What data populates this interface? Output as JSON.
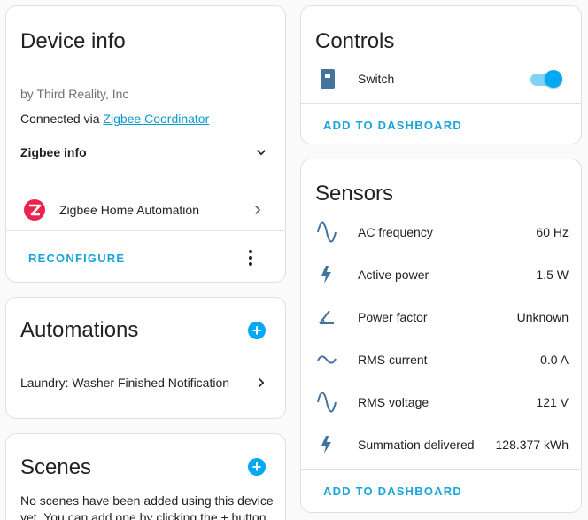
{
  "device_info": {
    "title": "Device info",
    "manufacturer": "by Third Reality, Inc",
    "connected_prefix": "Connected via ",
    "connected_link": "Zigbee Coordinator",
    "zigbee_info_label": "Zigbee info",
    "integration_label": "Zigbee Home Automation",
    "reconfigure_label": "RECONFIGURE",
    "integration_icon": "zigbee-logo-icon"
  },
  "automations": {
    "title": "Automations",
    "items": [
      {
        "label": "Laundry: Washer Finished Notification"
      }
    ]
  },
  "scenes": {
    "title": "Scenes",
    "empty_text_line1": "No scenes have been added using this device",
    "empty_text_line2": "yet. You can add one by clicking the + button"
  },
  "controls": {
    "title": "Controls",
    "items": [
      {
        "label": "Switch",
        "icon": "power-socket-icon",
        "state": "on"
      }
    ],
    "add_to_dashboard_label": "ADD TO DASHBOARD"
  },
  "sensors": {
    "title": "Sensors",
    "items": [
      {
        "label": "AC frequency",
        "value": "60 Hz",
        "icon": "sine-wave-icon"
      },
      {
        "label": "Active power",
        "value": "1.5 W",
        "icon": "lightning-bolt-icon"
      },
      {
        "label": "Power factor",
        "value": "Unknown",
        "icon": "angle-icon"
      },
      {
        "label": "RMS current",
        "value": "0.0 A",
        "icon": "current-ac-icon"
      },
      {
        "label": "RMS voltage",
        "value": "121 V",
        "icon": "sine-wave-icon"
      },
      {
        "label": "Summation delivered",
        "value": "128.377 kWh",
        "icon": "lightning-bolt-icon"
      }
    ],
    "add_to_dashboard_label": "ADD TO DASHBOARD"
  },
  "colors": {
    "accent": "#03a9f4",
    "link": "#0a9bcf",
    "action": "#1aa5d9",
    "zigbee": "#e8254c",
    "icon": "#44739e"
  }
}
